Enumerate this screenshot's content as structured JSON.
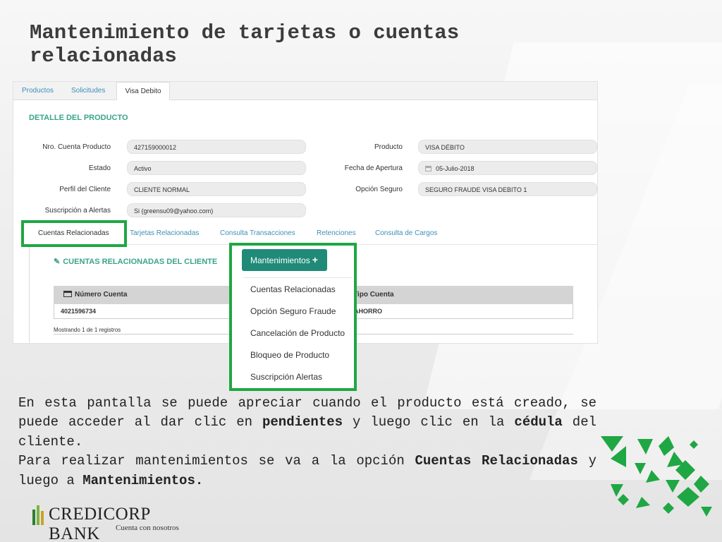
{
  "slide": {
    "title_line1": "Mantenimiento de tarjetas o cuentas",
    "title_line2": "relacionadas"
  },
  "screen": {
    "top_tabs": [
      "Productos",
      "Solicitudes",
      "Visa Debito"
    ],
    "active_top_tab": "Visa Debito",
    "section_title": "DETALLE DEL PRODUCTO",
    "fields_left": [
      {
        "label": "Nro. Cuenta Producto",
        "value": "427159000012"
      },
      {
        "label": "Estado",
        "value": "Activo"
      },
      {
        "label": "Perfil del Cliente",
        "value": "CLIENTE NORMAL"
      },
      {
        "label": "Suscripción a Alertas",
        "value": "Si (greensu09@yahoo.com)"
      }
    ],
    "fields_right": [
      {
        "label": "Producto",
        "value": "VISA DÉBITO"
      },
      {
        "label": "Fecha de Apertura",
        "value": "05-Julio-2018",
        "icon": "calendar-icon"
      },
      {
        "label": "Opción Seguro",
        "value": "SEGURO FRAUDE VISA DEBITO 1"
      }
    ],
    "sub_tabs": [
      "Cuentas Relacionadas",
      "Tarjetas Relacionadas",
      "Consulta Transacciones",
      "Retenciones",
      "Consulta de Cargos"
    ],
    "active_sub_tab": "Cuentas Relacionadas",
    "related_title": "CUENTAS RELACIONADAS DEL CLIENTE",
    "related_icon": "paperclip-icon",
    "table": {
      "columns": [
        "Número Cuenta",
        "Tipo Cuenta"
      ],
      "rows": [
        [
          "4021596734",
          "AHORRO"
        ]
      ],
      "footer": "Mostrando 1 de 1 registros"
    },
    "menu": {
      "button_label": "Mantenimientos",
      "button_icon": "plus-icon",
      "items": [
        "Cuentas Relacionadas",
        "Opción Seguro Fraude",
        "Cancelación de Producto",
        "Bloqueo de Producto",
        "Suscripción Alertas"
      ]
    }
  },
  "paragraph": {
    "line1": "En esta pantalla se puede apreciar cuando el producto está creado, se puede acceder al dar clic en ",
    "bold1": "pendientes",
    "line2": " y luego clic en la ",
    "bold2": "cédula",
    "line3": " del cliente.",
    "line4": "Para realizar mantenimientos se va a la opción ",
    "bold3": "Cuentas Relacionadas",
    "line5": " y luego a ",
    "bold4": "Mantenimientos."
  },
  "footer": {
    "brand": "CREDICORP BANK",
    "tagline": "Cuenta con nosotros"
  },
  "colors": {
    "accent_green": "#1fa743",
    "teal_button": "#1f8a78",
    "section_teal": "#3aa38c",
    "link_blue": "#3e8fb8"
  }
}
